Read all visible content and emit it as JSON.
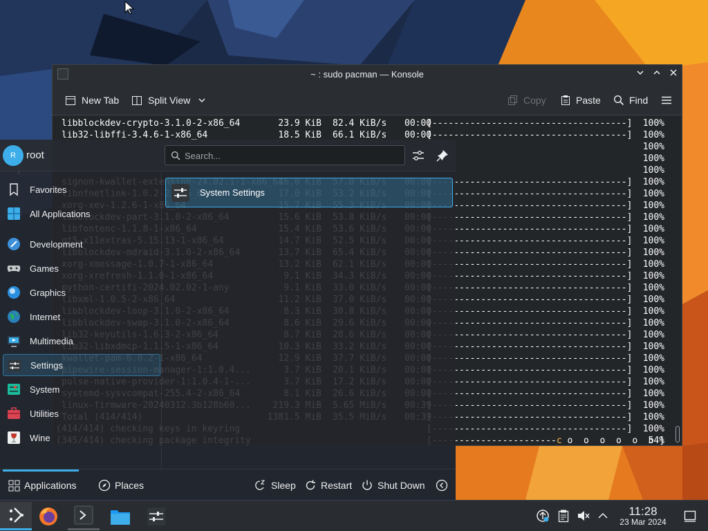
{
  "window": {
    "title": "~ : sudo pacman — Konsole"
  },
  "toolbar": {
    "new_tab": "New Tab",
    "split_view": "Split View",
    "copy": "Copy",
    "paste": "Paste",
    "find": "Find"
  },
  "terminal": {
    "rows": [
      {
        "pkg": "libblockdev-crypto-3.1.0-2-x86_64",
        "size": "23.9 KiB",
        "rate": "82.4 KiB/s",
        "time": "00:00",
        "bar": "[------------------------------------]",
        "pct": "100%"
      },
      {
        "pkg": "lib32-libffi-3.4.6-1-x86_64",
        "size": "18.5 KiB",
        "rate": "66.1 KiB/s",
        "time": "00:00",
        "bar": "[------------------------------------]",
        "pct": "100%"
      },
      {
        "pkg": "",
        "size": "",
        "rate": "",
        "time": "",
        "bar": "------]",
        "pct": "100%"
      },
      {
        "pkg": "",
        "size": "",
        "rate": "",
        "time": "",
        "bar": "------]",
        "pct": "100%"
      },
      {
        "pkg": "",
        "size": "",
        "rate": "",
        "time": "",
        "bar": "------]",
        "pct": "100%"
      },
      {
        "pkg": "signon-kwallet-extension-24.02.1-1-x86_64",
        "size": "16.0 KiB",
        "rate": "57.0 KiB/s",
        "time": "00:00",
        "bar": "[------------------------------------]",
        "pct": "100%"
      },
      {
        "pkg": "libnfnetlink-1.0.2-2-x86_64",
        "size": "17.0 KiB",
        "rate": "53.2 KiB/s",
        "time": "00:00",
        "bar": "[------------------------------------]",
        "pct": "100%"
      },
      {
        "pkg": "xorg-xev-1.2.6-1-x86_64",
        "size": "15.7 KiB",
        "rate": "55.3 KiB/s",
        "time": "00:00",
        "bar": "[------------------------------------]",
        "pct": "100%"
      },
      {
        "pkg": "libblockdev-part-3.1.0-2-x86_64",
        "size": "15.6 KiB",
        "rate": "53.8 KiB/s",
        "time": "00:00",
        "bar": "[------------------------------------]",
        "pct": "100%"
      },
      {
        "pkg": "libfontenc-1.1.8-1-x86_64",
        "size": "15.4 KiB",
        "rate": "53.6 KiB/s",
        "time": "00:00",
        "bar": "[------------------------------------]",
        "pct": "100%"
      },
      {
        "pkg": "qt5-x11extras-5.15.13-1-x86_64",
        "size": "14.7 KiB",
        "rate": "52.5 KiB/s",
        "time": "00:00",
        "bar": "[------------------------------------]",
        "pct": "100%"
      },
      {
        "pkg": "libblockdev-mdraid-3.1.0-2-x86_64",
        "size": "13.7 KiB",
        "rate": "65.4 KiB/s",
        "time": "00:00",
        "bar": "[------------------------------------]",
        "pct": "100%"
      },
      {
        "pkg": "xorg-xmessage-1.0.7-1-x86_64",
        "size": "13.2 KiB",
        "rate": "62.1 KiB/s",
        "time": "00:00",
        "bar": "[------------------------------------]",
        "pct": "100%"
      },
      {
        "pkg": "xorg-xrefresh-1.1.0-1-x86_64",
        "size": "9.1 KiB",
        "rate": "34.3 KiB/s",
        "time": "00:00",
        "bar": "[------------------------------------]",
        "pct": "100%"
      },
      {
        "pkg": "python-certifi-2024.02.02-1-any",
        "size": "9.1 KiB",
        "rate": "33.0 KiB/s",
        "time": "00:00",
        "bar": "[------------------------------------]",
        "pct": "100%"
      },
      {
        "pkg": "libxml-1.0.5-2-x86_64",
        "size": "11.2 KiB",
        "rate": "37.0 KiB/s",
        "time": "00:00",
        "bar": "[------------------------------------]",
        "pct": "100%"
      },
      {
        "pkg": "libblockdev-loop-3.1.0-2-x86_64",
        "size": "8.3 KiB",
        "rate": "30.8 KiB/s",
        "time": "00:00",
        "bar": "[------------------------------------]",
        "pct": "100%"
      },
      {
        "pkg": "libblockdev-swap-3.1.0-2-x86_64",
        "size": "8.6 KiB",
        "rate": "29.6 KiB/s",
        "time": "00:00",
        "bar": "[------------------------------------]",
        "pct": "100%"
      },
      {
        "pkg": "lib32-keyutils-1.6.3-2-x86_64",
        "size": "8.7 KiB",
        "rate": "28.6 KiB/s",
        "time": "00:00",
        "bar": "[------------------------------------]",
        "pct": "100%"
      },
      {
        "pkg": "lib32-libxdmcp-1.1.5-1-x86_64",
        "size": "10.3 KiB",
        "rate": "33.2 KiB/s",
        "time": "00:00",
        "bar": "[------------------------------------]",
        "pct": "100%"
      },
      {
        "pkg": "kwallet-pam-6.0.2-1-x86_64",
        "size": "12.9 KiB",
        "rate": "37.7 KiB/s",
        "time": "00:00",
        "bar": "[------------------------------------]",
        "pct": "100%"
      },
      {
        "pkg": "pipewire-session-manager-1:1.0.4...",
        "size": "3.7 KiB",
        "rate": "20.1 KiB/s",
        "time": "00:00",
        "bar": "[------------------------------------]",
        "pct": "100%"
      },
      {
        "pkg": "pulse-native-provider-1:1.0.4-1-...",
        "size": "3.7 KiB",
        "rate": "17.2 KiB/s",
        "time": "00:00",
        "bar": "[------------------------------------]",
        "pct": "100%"
      },
      {
        "pkg": "systemd-sysvcompat-255.4-2-x86_64",
        "size": "8.1 KiB",
        "rate": "26.6 KiB/s",
        "time": "00:00",
        "bar": "[------------------------------------]",
        "pct": "100%"
      },
      {
        "pkg": "linux-firmware-20240312.3b128b60...",
        "size": "219.3 MiB",
        "rate": "5.65 MiB/s",
        "time": "00:39",
        "bar": "[------------------------------------]",
        "pct": "100%"
      },
      {
        "pkg": "Total (414/414)",
        "size": "1381.5 MiB",
        "rate": "35.5 MiB/s",
        "time": "00:39",
        "bar": "[------------------------------------]",
        "pct": "100%"
      }
    ],
    "status_lines": [
      {
        "msg": "(414/414) checking keys in keyring",
        "bar": "[------------------------------------]",
        "pct": "100%"
      },
      {
        "msg": "(345/414) checking package integrity",
        "bar_left": "[-----------------------",
        "bar_c": "c",
        "bar_right": " o  o  o  o  o  o ]",
        "pct": "54%"
      }
    ]
  },
  "launcher": {
    "user": "root",
    "avatar_letter": "R",
    "search_placeholder": "Search...",
    "categories": [
      {
        "label": "Favorites",
        "icon": "bookmark-icon"
      },
      {
        "label": "All Applications",
        "icon": "grid-icon"
      },
      {
        "label": "Development",
        "icon": "development-icon"
      },
      {
        "label": "Games",
        "icon": "gamepad-icon"
      },
      {
        "label": "Graphics",
        "icon": "graphics-icon"
      },
      {
        "label": "Internet",
        "icon": "globe-icon"
      },
      {
        "label": "Multimedia",
        "icon": "multimedia-icon"
      },
      {
        "label": "Settings",
        "icon": "settings-icon"
      },
      {
        "label": "System",
        "icon": "system-icon"
      },
      {
        "label": "Utilities",
        "icon": "utilities-icon"
      },
      {
        "label": "Wine",
        "icon": "wine-icon"
      }
    ],
    "active_category": "Settings",
    "result": "System Settings",
    "footer": {
      "applications": "Applications",
      "places": "Places",
      "sleep": "Sleep",
      "restart": "Restart",
      "shutdown": "Shut Down"
    }
  },
  "taskbar": {
    "time": "11:28",
    "date": "23 Mar 2024"
  },
  "colors": {
    "accent": "#3daee9",
    "window_bg": "#232629",
    "terminal_c": "#fdbc4b"
  }
}
